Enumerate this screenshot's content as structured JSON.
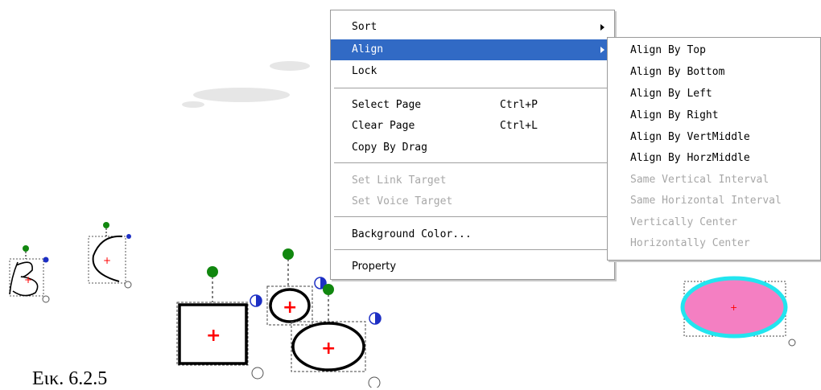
{
  "context_menu": {
    "items": [
      {
        "label": "Sort",
        "has_submenu": true
      },
      {
        "label": "Align",
        "has_submenu": true,
        "selected": true
      },
      {
        "label": "Lock"
      },
      {
        "label": "Select Page",
        "shortcut": "Ctrl+P"
      },
      {
        "label": "Clear Page",
        "shortcut": "Ctrl+L"
      },
      {
        "label": "Copy By Drag"
      },
      {
        "label": "Set Link Target",
        "disabled": true
      },
      {
        "label": "Set Voice Target",
        "disabled": true
      },
      {
        "label": "Background Color..."
      },
      {
        "label": "Property"
      }
    ]
  },
  "align_submenu": {
    "items": [
      {
        "label": "Align By Top"
      },
      {
        "label": "Align By Bottom"
      },
      {
        "label": "Align By Left"
      },
      {
        "label": "Align By Right"
      },
      {
        "label": "Align By VertMiddle"
      },
      {
        "label": "Align By HorzMiddle"
      },
      {
        "label": "Same Vertical Interval",
        "disabled": true
      },
      {
        "label": "Same Horizontal Interval",
        "disabled": true
      },
      {
        "label": "Vertically Center",
        "disabled": true
      },
      {
        "label": "Horizontally Center",
        "disabled": true
      }
    ]
  },
  "caption": "Εικ. 6.2.5",
  "colors": {
    "menu_highlight": "#316ac5",
    "handle_green": "#11870f",
    "handle_blue": "#1d2fc4",
    "center_mark": "#ff0000",
    "ellipse_fill": "#f47fc2",
    "ellipse_outline": "#22e5ef"
  },
  "canvas_objects": [
    "handwritten-b-glyph",
    "curve-stroke",
    "square-shape",
    "small-circle-shape",
    "ellipse-shape",
    "pink-ellipse-shape"
  ]
}
